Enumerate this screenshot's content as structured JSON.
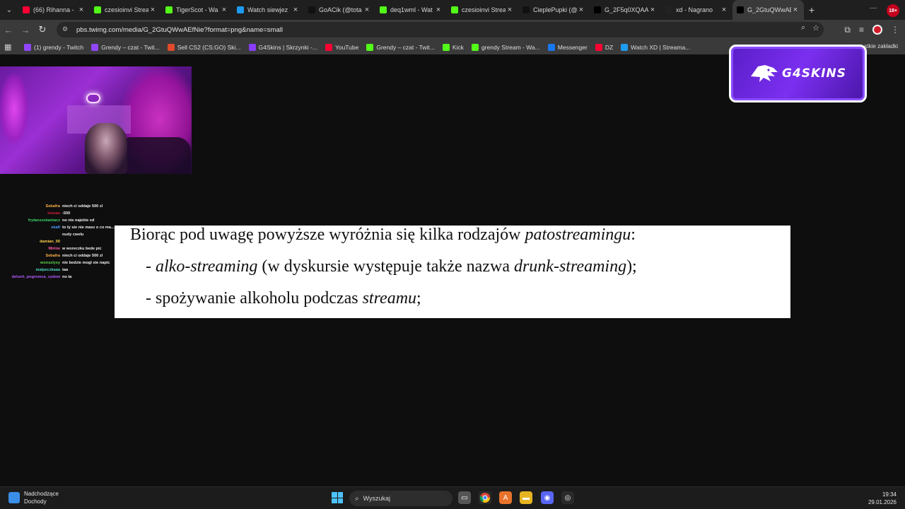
{
  "browser": {
    "tabs": [
      {
        "title": "(66) Rihanna -",
        "icon": "youtube-icon",
        "color": "#ff0033"
      },
      {
        "title": "czesioinvi Strea",
        "icon": "kick-icon",
        "color": "#53fc18"
      },
      {
        "title": "TigerScot - Wa",
        "icon": "kick-icon",
        "color": "#53fc18"
      },
      {
        "title": "Watch siewjez",
        "icon": "watch-icon",
        "color": "#1d9bf0"
      },
      {
        "title": "GoACik (@tota",
        "icon": "tiktok-icon",
        "color": "#111111"
      },
      {
        "title": "deq1wml - Wat",
        "icon": "kick-icon",
        "color": "#53fc18"
      },
      {
        "title": "czesioinvi Strea",
        "icon": "kick-icon",
        "color": "#53fc18"
      },
      {
        "title": "CieplePupki (@",
        "icon": "tiktok-icon",
        "color": "#111111"
      },
      {
        "title": "G_2F5q0XQAA",
        "icon": "x-icon",
        "color": "#000000"
      },
      {
        "title": "xd - Nagrano",
        "icon": "medal-icon",
        "color": "#222222"
      },
      {
        "title": "G_2GtuQWwAE",
        "icon": "x-icon",
        "color": "#000000",
        "active": true
      }
    ],
    "url": "pbs.twimg.com/media/G_2GtuQWwAEfNie?format=png&name=small",
    "bookmarks": [
      {
        "label": "(1) grendy - Twitch",
        "icon": "twitch-icon",
        "color": "#9146ff"
      },
      {
        "label": "Grendy – czat - Twit...",
        "icon": "twitch-icon",
        "color": "#9146ff"
      },
      {
        "label": "Sell CS2 (CS:GO) Ski...",
        "icon": "skins-icon",
        "color": "#e14a2a"
      },
      {
        "label": "G4Skins | Skrzynki -...",
        "icon": "g4skins-icon",
        "color": "#8a3cff"
      },
      {
        "label": "YouTube",
        "icon": "youtube-icon",
        "color": "#ff0033"
      },
      {
        "label": "Grendy – czat - Twit...",
        "icon": "kick-icon",
        "color": "#53fc18"
      },
      {
        "label": "Kick",
        "icon": "kick-icon",
        "color": "#53fc18"
      },
      {
        "label": "grendy Stream - Wa...",
        "icon": "kick-icon",
        "color": "#53fc18"
      },
      {
        "label": "Messenger",
        "icon": "facebook-icon",
        "color": "#1877f2"
      },
      {
        "label": "DZ",
        "icon": "youtube-icon",
        "color": "#ff0033"
      },
      {
        "label": "Watch XD | Streama...",
        "icon": "watch-icon",
        "color": "#1d9bf0"
      }
    ],
    "bookmarks_all": "stkie zakładki",
    "profile_badge": "18+"
  },
  "chat": [
    {
      "user": "Sebafra",
      "color": "#ffb14a",
      "msg": "niech ci oddaje 500 zl"
    },
    {
      "user": "louvas",
      "color": "#d81e3a",
      "msg": "-500"
    },
    {
      "user": "frytaoszolamiacz",
      "color": "#3bd86a",
      "msg": "no nie najebie xd"
    },
    {
      "user": "skafi",
      "color": "#4aa0ff",
      "msg": "to ty sie nie masz o co ma..."
    },
    {
      "user": "",
      "color": "#ffffff",
      "msg": "nudy cwelu"
    },
    {
      "user": "damian_00",
      "color": "#ffd24a",
      "msg": ""
    },
    {
      "user": "Mirine",
      "color": "#ff5aa0",
      "msg": "w woreczku bede pic"
    },
    {
      "user": "Sebafra",
      "color": "#ffb14a",
      "msg": "niech ci oddaje 500 zl"
    },
    {
      "user": "wonszlysy",
      "color": "#5ad84a",
      "msg": "nie bedzie mogl sie napic"
    },
    {
      "user": "malpeczkaaa",
      "color": "#4ad8c0",
      "msg": "taa"
    },
    {
      "user": "deluch_pogromca_zydow",
      "color": "#b45aff",
      "msg": "no ta"
    }
  ],
  "document": {
    "line1_pre": "Biorąc pod uwagę powyższe wyróżnia się kilka rodzajów ",
    "line1_em": "patostreamingu",
    "line1_post": ":",
    "line2_dash": "- ",
    "line2_em1": "alko-streaming",
    "line2_mid": " (w dyskursie występuje także nazwa ",
    "line2_em2": "drunk-streaming",
    "line2_post": ");",
    "line3_pre": "- spożywanie alkoholu podczas ",
    "line3_em": "streamu",
    "line3_post": ";"
  },
  "overlay": {
    "brand": "G4SKINS"
  },
  "taskbar": {
    "weather_title": "Nadchodzące",
    "weather_sub": "Dochody",
    "search_placeholder": "Wyszukaj",
    "time": "19:34",
    "date": "29.01.2026"
  }
}
